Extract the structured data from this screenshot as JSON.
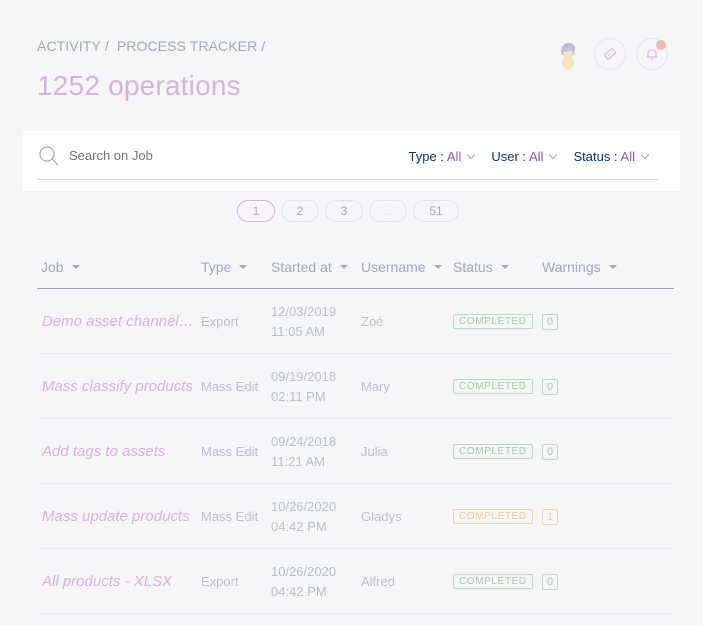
{
  "breadcrumb": [
    "ACTIVITY",
    "/",
    "PROCESS TRACKER",
    "/"
  ],
  "title": "1252 operations",
  "search": {
    "placeholder": "Search on Job"
  },
  "filters": [
    {
      "label": "Type :",
      "value": "All"
    },
    {
      "label": "User :",
      "value": "All"
    },
    {
      "label": "Status :",
      "value": "All"
    }
  ],
  "pagination": [
    "1",
    "2",
    "3",
    "...",
    "51"
  ],
  "columns": [
    "Job",
    "Type",
    "Started at",
    "Username",
    "Status",
    "Warnings"
  ],
  "rows": [
    {
      "job": "Demo asset channel export",
      "type": "Export",
      "date": "12/03/2019",
      "time": "11:05 AM",
      "user": "Zoé",
      "status": "COMPLETED",
      "warnings": "0"
    },
    {
      "job": "Mass classify products",
      "type": "Mass Edit",
      "date": "09/19/2018",
      "time": "02:11 PM",
      "user": "Mary",
      "status": "COMPLETED",
      "warnings": "0"
    },
    {
      "job": "Add tags to assets",
      "type": "Mass Edit",
      "date": "09/24/2018",
      "time": "11:21 AM",
      "user": "Julia",
      "status": "COMPLETED",
      "warnings": "0"
    },
    {
      "job": "Mass update products",
      "type": "Mass Edit",
      "date": "10/26/2020",
      "time": "04:42 PM",
      "user": "Gladys",
      "status": "COMPLETED",
      "warnings": "1"
    },
    {
      "job": "All products - XLSX",
      "type": "Export",
      "date": "10/26/2020",
      "time": "04:42 PM",
      "user": "Alfred",
      "status": "COMPLETED",
      "warnings": "0"
    }
  ],
  "colors": {
    "accent": "#9452ba",
    "ok": "#9ecca6",
    "warn": "#f2c697"
  }
}
